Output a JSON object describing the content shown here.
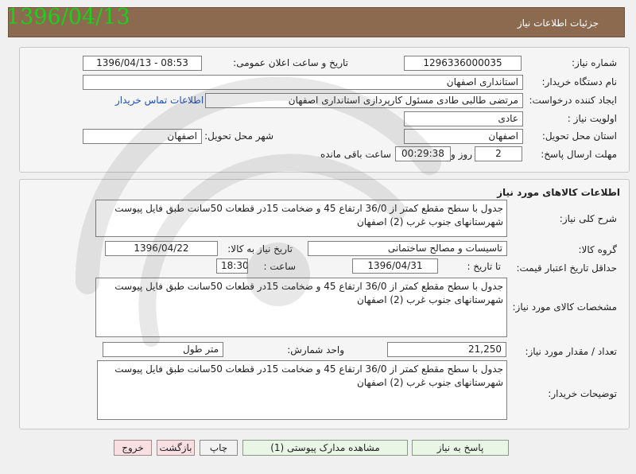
{
  "header": {
    "title": "جزئیات اطلاعات نیاز",
    "date_stamp": "1396/04/13"
  },
  "info": {
    "need_number_label": "شماره نیاز:",
    "need_number": "1296336000035",
    "announce_label": "تاریخ و ساعت اعلان عمومی:",
    "announce_value": "1396/04/13 - 08:53",
    "buyer_org_label": "نام دستگاه خریدار:",
    "buyer_org": "استانداری اصفهان",
    "requester_label": "ایجاد کننده درخواست:",
    "requester": "مرتضی طالبی طادی مسئول کارپردازی استانداری اصفهان",
    "contact_link": "اطلاعات تماس خریدار",
    "priority_label": "اولویت نیاز :",
    "priority": "عادی",
    "province_label": "استان محل تحویل:",
    "province": "اصفهان",
    "city_label": "شهر محل تحویل:",
    "city": "اصفهان",
    "deadline_label": "مهلت ارسال پاسخ:",
    "days": "2",
    "days_and": "روز و",
    "time_left": "00:29:38",
    "time_left_suffix": "ساعت باقی مانده"
  },
  "goods": {
    "section_title": "اطلاعات کالاهای مورد نیاز",
    "summary_label": "شرح کلی نیاز:",
    "summary": "جدول با سطح مقطع کمتر از 36/0 ارتفاع 45 و ضخامت 15در قطعات 50سانت طبق فایل پیوست شهرستانهای جنوب غرب (2) اصفهان",
    "group_label": "گروه کالا:",
    "group": "تاسیسات و مصالح ساختمانی",
    "need_date_label": "تاریخ نیاز به کالا:",
    "need_date": "1396/04/22",
    "validity_label": "حداقل تاریخ اعتبار قیمت:",
    "validity_until": "تا تاریخ :",
    "validity_date": "1396/04/31",
    "time_label": "ساعت :",
    "validity_time": "18:30",
    "specs_label": "مشخصات کالای مورد نیاز:",
    "specs": "جدول با سطح مقطع کمتر از 36/0 ارتفاع 45 و ضخامت 15در قطعات 50سانت طبق فایل پیوست شهرستانهای جنوب غرب (2) اصفهان",
    "quantity_label": "تعداد / مقدار مورد نیاز:",
    "quantity": "21,250",
    "unit_label": "واحد شمارش:",
    "unit": "متر طول",
    "buyer_notes_label": "توضیحات خریدار:",
    "buyer_notes": "جدول با سطح مقطع کمتر از 36/0 ارتفاع 45 و ضخامت 15در قطعات 50سانت طبق فایل پیوست شهرستانهای جنوب غرب (2) اصفهان"
  },
  "buttons": {
    "reply": "پاسخ به نیاز",
    "attachments": "مشاهده مدارک پیوستی (1)",
    "print": "چاپ",
    "back": "بازگشت",
    "exit": "خروج"
  }
}
